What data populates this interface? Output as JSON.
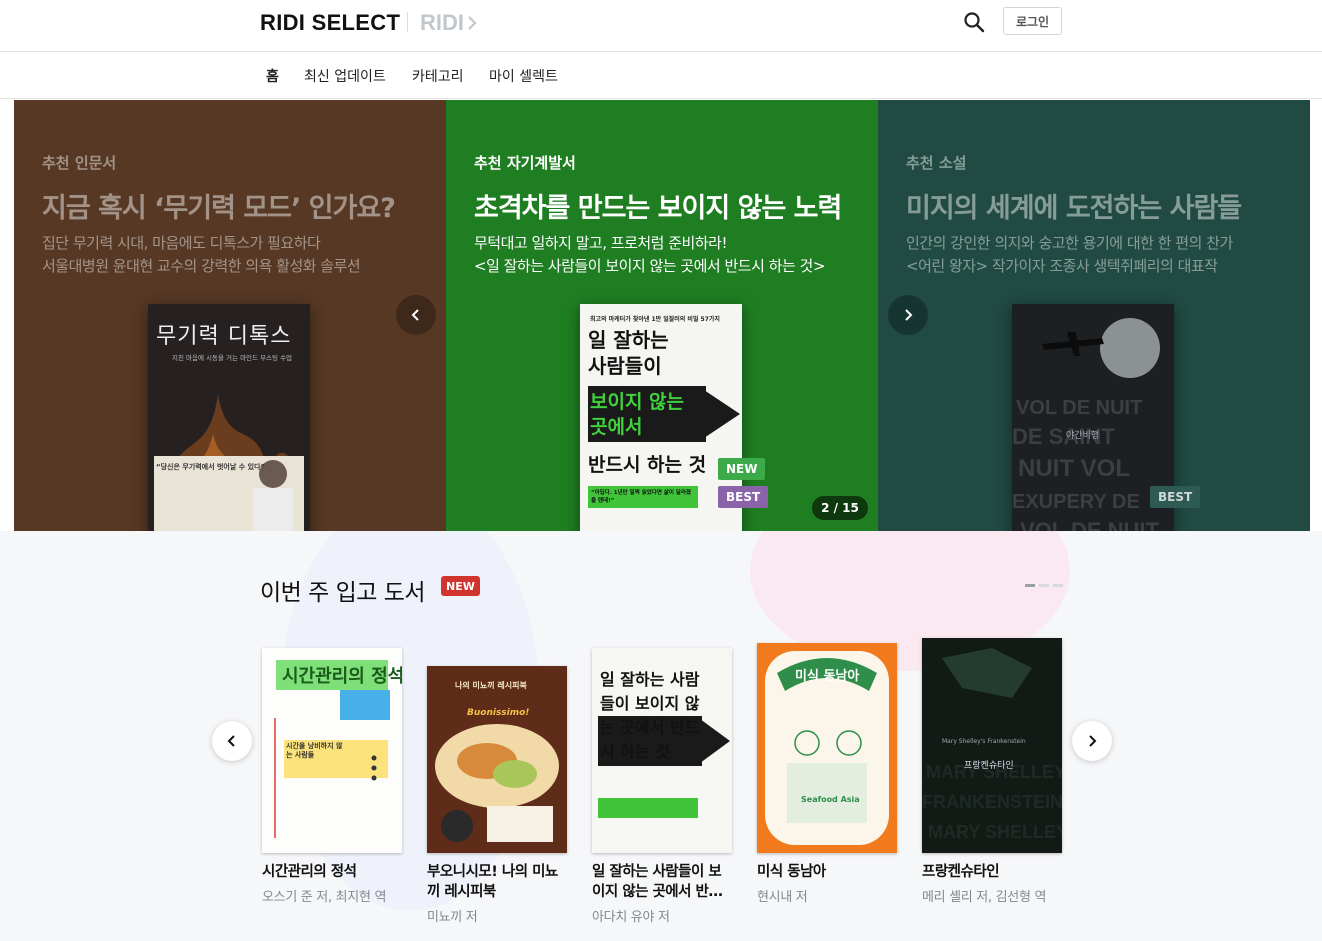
{
  "header": {
    "logo": "RIDI SELECT",
    "ridi_link": "RIDI",
    "login_label": "로그인"
  },
  "nav": {
    "items": [
      "홈",
      "최신 업데이트",
      "카테고리",
      "마이 셀렉트"
    ],
    "active": "홈"
  },
  "carousel": {
    "slides": [
      {
        "eyebrow": "추천 인문서",
        "title": "지금 혹시 ‘무기력 모드’ 인가요?",
        "desc1": "집단 무기력 시대, 마음에도 디톡스가 필요하다",
        "desc2": "서울대병원 윤대현 교수의 강력한 의욕 활성화 솔루션",
        "cover_title": "무기력 디톡스",
        "cover_subtitle": "지친 마음에 시동을 거는 마인드 부스팅 수업",
        "cover_quote": "“당신은 무기력에서 벗어날 수 있다”",
        "color": "#563824"
      },
      {
        "eyebrow": "추천 자기계발서",
        "title": "초격차를 만드는 보이지 않는 노력",
        "desc1": "무턱대고 일하지 말고, 프로처럼 준비하라!",
        "desc2": "<일 잘하는 사람들이 보이지 않는 곳에서 반드시 하는 것>",
        "cover_top": "최고의 마케터가 찾아낸 1만 일잘러의 비밀 57가지",
        "cover_line1": "일 잘하는",
        "cover_line2": "사람들이",
        "cover_line3": "보이지 않는",
        "cover_line4": "곳에서",
        "cover_line5": "반드시 하는 것",
        "cover_quote": "“아딥다. 1년만 일찍 읽었다면 삶이 달라졌을 텐데!”",
        "badge_new": "NEW",
        "badge_best": "BEST",
        "color": "#1f7e22"
      },
      {
        "eyebrow": "추천 소설",
        "title": "미지의 세계에 도전하는 사람들",
        "desc1": "인간의 강인한 의지와 숭고한 용기에 대한 한 편의 찬가",
        "desc2": "<어린 왕자> 작가이자 조종사 생텍쥐페리의 대표작",
        "cover_title": "야간비행",
        "badge_best": "BEST",
        "color": "#214a43"
      }
    ],
    "counter": "2 / 15"
  },
  "section": {
    "title": "이번 주 입고 도서",
    "badge": "NEW",
    "books": [
      {
        "title": "시간관리의 정석",
        "author": "오스기 준 저, 최지현 역",
        "cover_text": "시간관리의 정석",
        "cover_sub": "시간을 낭비하지 않는 사람들"
      },
      {
        "title": "부오니시모! 나의 미뇨끼 레시피북",
        "author": "미뇨끼 저",
        "cover_text": "나의 미뇨끼 레시피북",
        "cover_sub": "Buonissimo!"
      },
      {
        "title": "일 잘하는 사람들이 보이지 않는 곳에서 반…",
        "author": "아다치 유야 저",
        "cover_text": "일 잘하는 사람들이 보이지 않는 곳에서 반드시 하는 것"
      },
      {
        "title": "미식 동남아",
        "author": "현시내 저",
        "cover_text": "미식 동남아",
        "cover_sub": "Seafood Asia"
      },
      {
        "title": "프랑켄슈타인",
        "author": "메리 셸리 저, 김선형 역",
        "cover_text": "프랑켄슈타인",
        "cover_sub": "Mary Shelley's Frankenstein"
      }
    ]
  },
  "icons": {
    "search": "search-icon",
    "prev": "chevron-left-icon",
    "next": "chevron-right-icon"
  }
}
